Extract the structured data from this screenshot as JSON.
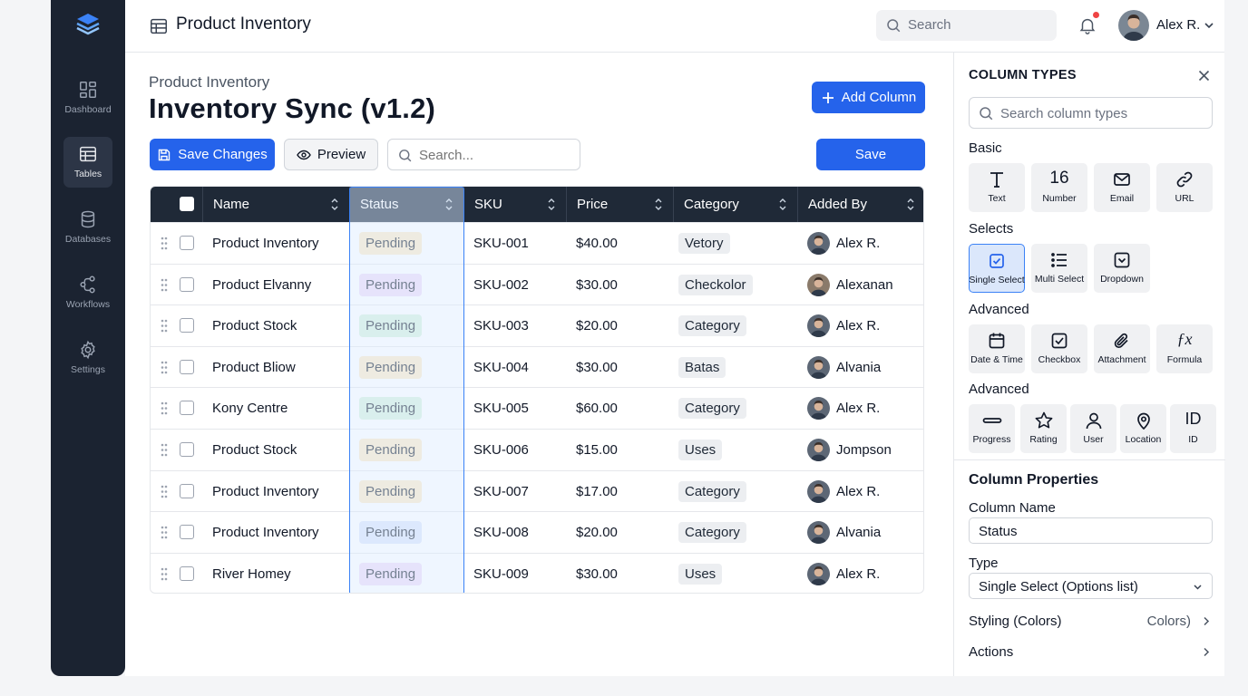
{
  "app": {
    "title": "Product Inventory"
  },
  "sidebar": {
    "items": [
      {
        "label": "Dashboard",
        "icon": "dashboard-icon"
      },
      {
        "label": "Tables",
        "icon": "table-icon"
      },
      {
        "label": "Databases",
        "icon": "database-icon"
      },
      {
        "label": "Workflows",
        "icon": "workflow-icon"
      },
      {
        "label": "Settings",
        "icon": "gear-icon"
      }
    ],
    "active": "Tables"
  },
  "topbar": {
    "search_placeholder": "Search",
    "user_name": "Alex R."
  },
  "page": {
    "breadcrumb": "Product Inventory",
    "title": "Inventory Sync (v1.2)"
  },
  "toolbar": {
    "add_column": "Add Column",
    "save_changes": "Save Changes",
    "preview": "Preview",
    "search_placeholder": "Search...",
    "save": "Save"
  },
  "table": {
    "headers": [
      "Name",
      "Status",
      "SKU",
      "Price",
      "Category",
      "Added By"
    ],
    "rows": [
      {
        "name": "Product Inventory",
        "status": "Pending",
        "status_color": "#fdecc8",
        "sku": "SKU-001",
        "price": "$40.00",
        "category": "Vetory",
        "user": "Alex R."
      },
      {
        "name": "Product Elvanny",
        "status": "Pending",
        "status_color": "#eedcf7",
        "sku": "SKU-002",
        "price": "$30.00",
        "category": "Checkolor",
        "user": "Alexanan"
      },
      {
        "name": "Product Stock",
        "status": "Pending",
        "status_color": "#d7f2df",
        "sku": "SKU-003",
        "price": "$20.00",
        "category": "Category",
        "user": "Alex R."
      },
      {
        "name": "Product Bliow",
        "status": "Pending",
        "status_color": "#fdecc8",
        "sku": "SKU-004",
        "price": "$30.00",
        "category": "Batas",
        "user": "Alvania"
      },
      {
        "name": "Kony Centre",
        "status": "Pending",
        "status_color": "#d7f2df",
        "sku": "SKU-005",
        "price": "$60.00",
        "category": "Category",
        "user": "Alex R."
      },
      {
        "name": "Product Stock",
        "status": "Pending",
        "status_color": "#fdecc8",
        "sku": "SKU-006",
        "price": "$15.00",
        "category": "Uses",
        "user": "Jompson"
      },
      {
        "name": "Product Inventory",
        "status": "Pending",
        "status_color": "#fdecc8",
        "sku": "SKU-007",
        "price": "$17.00",
        "category": "Category",
        "user": "Alex R."
      },
      {
        "name": "Product Inventory",
        "status": "Pending",
        "status_color": "#dde5fb",
        "sku": "SKU-008",
        "price": "$20.00",
        "category": "Category",
        "user": "Alvania"
      },
      {
        "name": "River Homey",
        "status": "Pending",
        "status_color": "#eedcf7",
        "sku": "SKU-009",
        "price": "$30.00",
        "category": "Uses",
        "user": "Alex R."
      }
    ]
  },
  "panel": {
    "title": "COLUMN TYPES",
    "search_placeholder": "Search column types",
    "sections": {
      "basic": "Basic",
      "selects": "Selects",
      "advanced1": "Advanced",
      "advanced2": "Advanced"
    },
    "basic": [
      {
        "label": "Text",
        "icon": "text-icon"
      },
      {
        "label": "Number",
        "icon": "number-icon"
      },
      {
        "label": "Email",
        "icon": "email-icon"
      },
      {
        "label": "URL",
        "icon": "link-icon"
      }
    ],
    "selects": [
      {
        "label": "Single Select",
        "icon": "single-select-icon"
      },
      {
        "label": "Multi Select",
        "icon": "multi-select-icon"
      },
      {
        "label": "Dropdown",
        "icon": "dropdown-icon"
      }
    ],
    "advanced1": [
      {
        "label": "Date & Time",
        "icon": "calendar-icon"
      },
      {
        "label": "Checkbox",
        "icon": "checkbox-icon"
      },
      {
        "label": "Attachment",
        "icon": "paperclip-icon"
      },
      {
        "label": "Formula",
        "icon": "formula-icon"
      }
    ],
    "advanced2": [
      {
        "label": "Progress",
        "icon": "progress-icon"
      },
      {
        "label": "Rating",
        "icon": "star-icon"
      },
      {
        "label": "User",
        "icon": "user-icon"
      },
      {
        "label": "Location",
        "icon": "location-pin-icon"
      },
      {
        "label": "ID",
        "icon": "id-icon"
      }
    ],
    "number_glyph": "16",
    "id_glyph": "ID",
    "formula_glyph": "ƒx",
    "properties": {
      "heading": "Column Properties",
      "name_label": "Column Name",
      "name_value": "Status",
      "type_label": "Type",
      "type_value": "Single Select (Options list)",
      "styling_label": "Styling (Colors)",
      "styling_value": "Colors)",
      "actions_label": "Actions"
    }
  }
}
